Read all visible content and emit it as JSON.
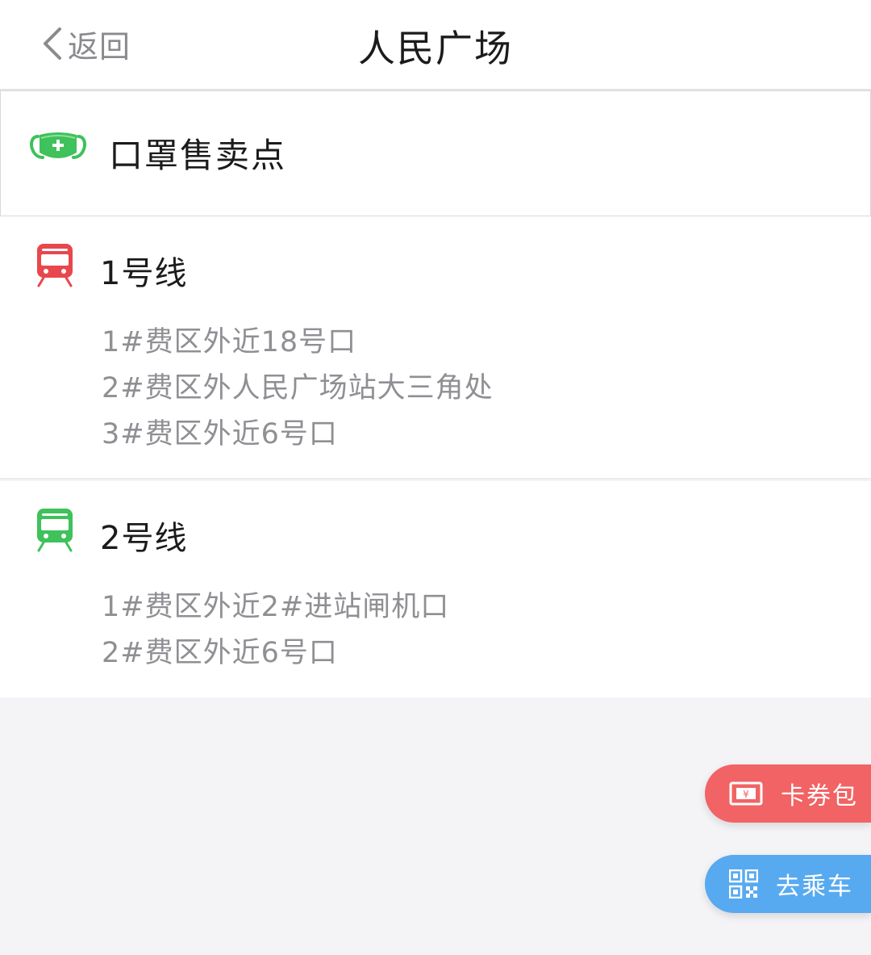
{
  "nav": {
    "back_label": "返回",
    "title": "人民广场"
  },
  "mask_card": {
    "icon": "mask-icon",
    "title": "口罩售卖点"
  },
  "lines": [
    {
      "name": "1号线",
      "icon": "train-icon",
      "color": "#e8474d",
      "points": [
        "1#费区外近18号口",
        "2#费区外人民广场站大三角处",
        "3#费区外近6号口"
      ]
    },
    {
      "name": "2号线",
      "icon": "train-icon",
      "color": "#3fc15b",
      "points": [
        "1#费区外近2#进站闸机口",
        "2#费区外近6号口"
      ]
    }
  ],
  "floating_buttons": {
    "wallet": {
      "label": "卡券包",
      "icon": "ticket-icon",
      "color": "#f16364"
    },
    "ride": {
      "label": "去乘车",
      "icon": "qr-code-icon",
      "color": "#58aaf0"
    }
  },
  "colors": {
    "background": "#f4f4f7",
    "mask_green": "#3fc15b"
  }
}
